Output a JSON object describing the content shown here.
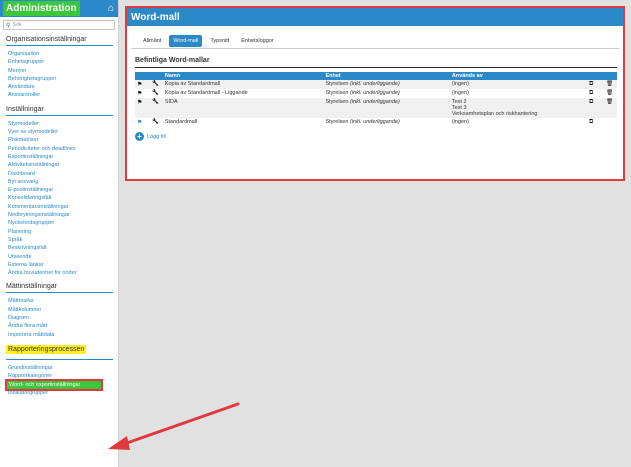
{
  "sidebar": {
    "title": "Administration",
    "search_placeholder": "Sök",
    "sections": [
      {
        "title": "Organisationsinställningar",
        "highlighted": false,
        "items": [
          "Organisation",
          "Enhetsgrupper",
          "Menyer",
          "Behörighetsgrupper",
          "Användare",
          "Ansvarsroller"
        ]
      },
      {
        "title": "Inställningar",
        "highlighted": false,
        "items": [
          "Styrmodeller",
          "Vyer av styrmodeller",
          "Riskmatriser",
          "Periodiciteter och deadlines",
          "Exportinställningar",
          "Aktivitetsinställningar",
          "Dashboard",
          "Byt ansvarig",
          "E-postinställningar",
          "Konsolideringsfält",
          "Kommentarsinställningar",
          "Nedbrytningsinställningar",
          "Nyckelordsgrupper",
          "Planering",
          "Språk",
          "Beskrivningsfält",
          "Utseende",
          "Externa länkar",
          "Ändra huvudenhet för noder"
        ]
      },
      {
        "title": "Mättinställningar",
        "highlighted": false,
        "items": [
          "Måttmallar",
          "Måttkolumner",
          "Diagram",
          "Ändra flera mått",
          "Importera måttdata"
        ]
      },
      {
        "title": "Rapporteringsprocessen",
        "highlighted": true,
        "items": [
          "Grundinställningar",
          "Rapportkategorier",
          "Word- och exportinställningar",
          "Indikatorgrupper"
        ],
        "active_index": 2
      }
    ]
  },
  "main": {
    "title": "Word-mall",
    "tabs": [
      "Allmänt",
      "Word-mall",
      "Typsnitt",
      "Enhetsloggor"
    ],
    "active_tab": 1,
    "section_title": "Befintliga Word-mallar",
    "columns": [
      "",
      "",
      "Namn",
      "Enhet",
      "Används av",
      "",
      ""
    ],
    "rows": [
      {
        "name": "Kopia av Standardmall",
        "unit": "Styrelsen",
        "unit_note": "(inkl. underliggande)",
        "used_by": [
          "(ingen)"
        ],
        "deletable": true,
        "flag_color": "#111111"
      },
      {
        "name": "Kopia av Standardmall - Liggande",
        "unit": "Styrelsen",
        "unit_note": "(inkl. underliggande)",
        "used_by": [
          "(ingen)"
        ],
        "deletable": true,
        "flag_color": "#111111"
      },
      {
        "name": "SIDA",
        "unit": "Styrelsen",
        "unit_note": "(inkl. underliggande)",
        "used_by": [
          "Test 2",
          "Test 3",
          "Verksamhetsplan och riskhantering"
        ],
        "deletable": true,
        "flag_color": "#111111"
      },
      {
        "name": "Standardmall",
        "unit": "Styrelsen",
        "unit_note": "(inkl. underliggande)",
        "used_by": [
          "(ingen)"
        ],
        "deletable": false,
        "flag_color": "#2a89c6"
      }
    ],
    "add_label": "Lägg till"
  },
  "colors": {
    "accent_blue": "#2a89c6",
    "green": "#3cc63c",
    "annotation_red": "#e0393e",
    "highlight_yellow": "#ffee22"
  }
}
